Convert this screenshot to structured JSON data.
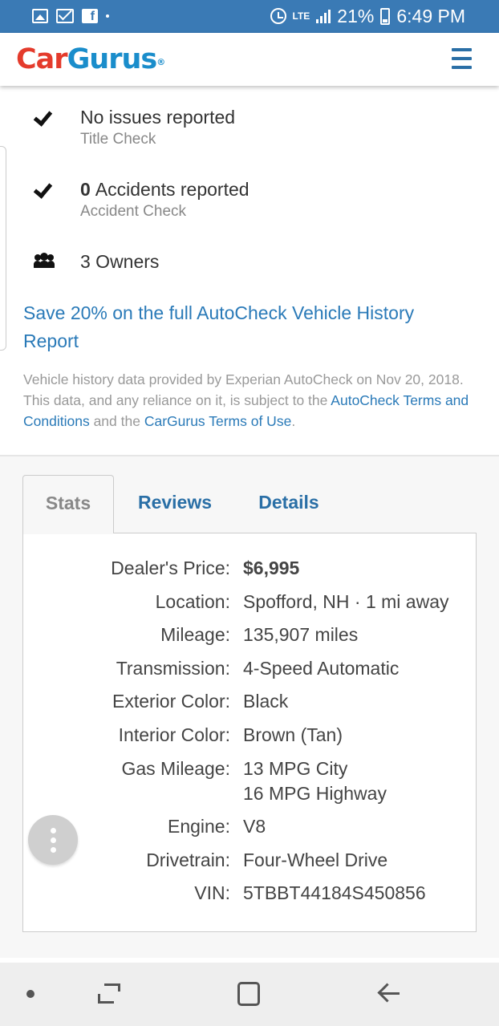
{
  "status_bar": {
    "battery": "21%",
    "time": "6:49 PM",
    "network": "LTE",
    "left_icons": [
      "gallery-icon",
      "mail-icon",
      "facebook-icon"
    ]
  },
  "header": {
    "logo_car": "Car",
    "logo_gurus": "Gurus",
    "logo_reg": "®",
    "menu_icon": "hamburger-menu-icon"
  },
  "history": {
    "title_check": {
      "main": "No issues reported",
      "sub": "Title Check"
    },
    "accident_check": {
      "count": "0",
      "main": "Accidents reported",
      "sub": "Accident Check"
    },
    "owners": "3 Owners",
    "save_link": "Save 20% on the full AutoCheck Vehicle History Report",
    "disclaimer": {
      "text1": "Vehicle history data provided by Experian AutoCheck on Nov 20, 2018. This data, and any reliance on it, is subject to the ",
      "link1": "AutoCheck Terms and Conditions",
      "text2": " and the ",
      "link2": "CarGurus Terms of Use",
      "text3": "."
    }
  },
  "tabs": {
    "stats": "Stats",
    "reviews": "Reviews",
    "details": "Details",
    "active": "Stats"
  },
  "stats": [
    {
      "label": "Dealer's Price:",
      "value": "$6,995",
      "bold": true
    },
    {
      "label": "Location:",
      "value": "Spofford, NH · 1 mi away"
    },
    {
      "label": "Mileage:",
      "value": "135,907 miles"
    },
    {
      "label": "Transmission:",
      "value": "4-Speed Automatic"
    },
    {
      "label": "Exterior Color:",
      "value": "Black"
    },
    {
      "label": "Interior Color:",
      "value": "Brown (Tan)"
    },
    {
      "label": "Gas Mileage:",
      "value": "13 MPG City",
      "value2": "16 MPG Highway"
    },
    {
      "label": "Engine:",
      "value": "V8"
    },
    {
      "label": "Drivetrain:",
      "value": "Four-Wheel Drive"
    },
    {
      "label": "VIN:",
      "value": "5TBBT44184S450856"
    }
  ],
  "nav_bar": {
    "icons": [
      "dot-icon",
      "recent-apps-icon",
      "home-icon",
      "back-icon"
    ]
  },
  "colors": {
    "status_bar": "#3a7ab5",
    "logo_red": "#e43b2c",
    "logo_blue": "#1a8dcb",
    "link_blue": "#2a7ab8"
  }
}
